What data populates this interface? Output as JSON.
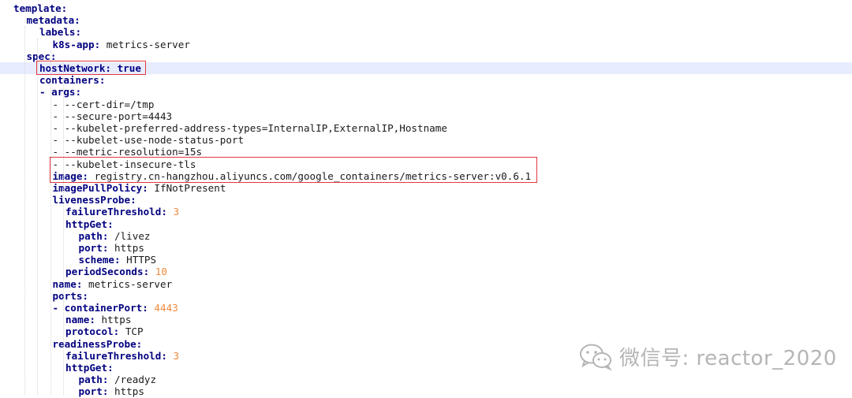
{
  "editor": {
    "current_line_index": 5,
    "lines": [
      {
        "indent": 1,
        "dash": "",
        "key": "template:",
        "value": "",
        "vtype": ""
      },
      {
        "indent": 2,
        "dash": "",
        "key": "metadata:",
        "value": "",
        "vtype": ""
      },
      {
        "indent": 3,
        "dash": "",
        "key": "labels:",
        "value": "",
        "vtype": ""
      },
      {
        "indent": 4,
        "dash": "",
        "key": "k8s-app:",
        "value": " metrics-server",
        "vtype": "plain"
      },
      {
        "indent": 2,
        "dash": "",
        "key": "spec:",
        "value": "",
        "vtype": ""
      },
      {
        "indent": 3,
        "dash": "",
        "key": "hostNetwork:",
        "value": " true",
        "vtype": "bool"
      },
      {
        "indent": 3,
        "dash": "",
        "key": "containers:",
        "value": "",
        "vtype": ""
      },
      {
        "indent": 3,
        "dash": "- ",
        "key": "args:",
        "value": "",
        "vtype": ""
      },
      {
        "indent": 4,
        "dash": "",
        "key": "",
        "value": "- --cert-dir=/tmp",
        "vtype": "plain"
      },
      {
        "indent": 4,
        "dash": "",
        "key": "",
        "value": "- --secure-port=4443",
        "vtype": "plain"
      },
      {
        "indent": 4,
        "dash": "",
        "key": "",
        "value": "- --kubelet-preferred-address-types=InternalIP,ExternalIP,Hostname",
        "vtype": "plain"
      },
      {
        "indent": 4,
        "dash": "",
        "key": "",
        "value": "- --kubelet-use-node-status-port",
        "vtype": "plain"
      },
      {
        "indent": 4,
        "dash": "",
        "key": "",
        "value": "- --metric-resolution=15s",
        "vtype": "plain"
      },
      {
        "indent": 4,
        "dash": "",
        "key": "",
        "value": "- --kubelet-insecure-tls",
        "vtype": "plain"
      },
      {
        "indent": 4,
        "dash": "",
        "key": "image:",
        "value": " registry.cn-hangzhou.aliyuncs.com/google_containers/metrics-server:v0.6.1",
        "vtype": "plain"
      },
      {
        "indent": 4,
        "dash": "",
        "key": "imagePullPolicy:",
        "value": " IfNotPresent",
        "vtype": "plain"
      },
      {
        "indent": 4,
        "dash": "",
        "key": "livenessProbe:",
        "value": "",
        "vtype": ""
      },
      {
        "indent": 5,
        "dash": "",
        "key": "failureThreshold:",
        "value": " 3",
        "vtype": "num"
      },
      {
        "indent": 5,
        "dash": "",
        "key": "httpGet:",
        "value": "",
        "vtype": ""
      },
      {
        "indent": 6,
        "dash": "",
        "key": "path:",
        "value": " /livez",
        "vtype": "plain"
      },
      {
        "indent": 6,
        "dash": "",
        "key": "port:",
        "value": " https",
        "vtype": "plain"
      },
      {
        "indent": 6,
        "dash": "",
        "key": "scheme:",
        "value": " HTTPS",
        "vtype": "plain"
      },
      {
        "indent": 5,
        "dash": "",
        "key": "periodSeconds:",
        "value": " 10",
        "vtype": "num"
      },
      {
        "indent": 4,
        "dash": "",
        "key": "name:",
        "value": " metrics-server",
        "vtype": "plain"
      },
      {
        "indent": 4,
        "dash": "",
        "key": "ports:",
        "value": "",
        "vtype": ""
      },
      {
        "indent": 4,
        "dash": "- ",
        "key": "containerPort:",
        "value": " 4443",
        "vtype": "num"
      },
      {
        "indent": 5,
        "dash": "",
        "key": "name:",
        "value": " https",
        "vtype": "plain"
      },
      {
        "indent": 5,
        "dash": "",
        "key": "protocol:",
        "value": " TCP",
        "vtype": "plain"
      },
      {
        "indent": 4,
        "dash": "",
        "key": "readinessProbe:",
        "value": "",
        "vtype": ""
      },
      {
        "indent": 5,
        "dash": "",
        "key": "failureThreshold:",
        "value": " 3",
        "vtype": "num"
      },
      {
        "indent": 5,
        "dash": "",
        "key": "httpGet:",
        "value": "",
        "vtype": ""
      },
      {
        "indent": 6,
        "dash": "",
        "key": "path:",
        "value": " /readyz",
        "vtype": "plain"
      },
      {
        "indent": 6,
        "dash": "",
        "key": "port:",
        "value": " https",
        "vtype": "plain"
      }
    ]
  },
  "highlights": [
    {
      "label": "hostNetwork",
      "from_line": 5,
      "to_line": 5
    },
    {
      "label": "insecure-tls-and-image",
      "from_line": 13,
      "to_line": 14
    }
  ],
  "watermark": {
    "icon": "wechat-icon",
    "text": "微信号: reactor_2020"
  }
}
